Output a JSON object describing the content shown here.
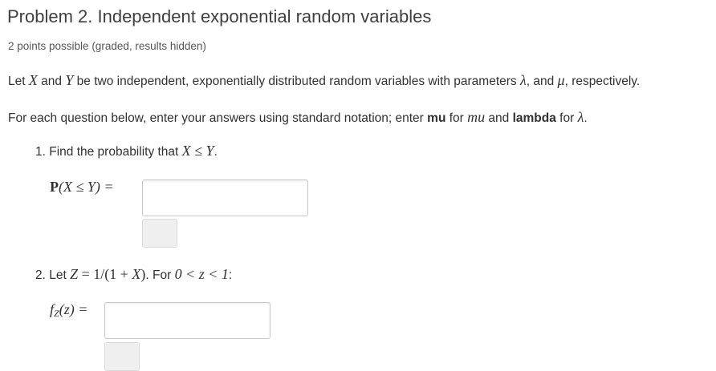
{
  "problem": {
    "title": "Problem 2. Independent exponential random variables",
    "points": "2 points possible (graded, results hidden)"
  },
  "intro": {
    "let": "Let ",
    "X": "X",
    "and": " and ",
    "Y": "Y",
    "desc": " be two independent, exponentially distributed random variables with parameters ",
    "lambda": "λ",
    "and2": ", and ",
    "mu": "μ",
    "end": ", respectively."
  },
  "instructions": {
    "t1": "For each question below, enter your answers using standard notation; enter ",
    "mu_kw": "mu",
    "t2": " for ",
    "mu_italic": "mu",
    "t3": " and ",
    "lambda_kw": "lambda",
    "t4": " for ",
    "lambda": "λ",
    "t5": "."
  },
  "q1": {
    "num": "1. Find the probability that ",
    "expr": "X ≤ Y",
    "end": ".",
    "label_P": "P",
    "label_expr": "(X ≤ Y) ="
  },
  "q2": {
    "num": "2. Let ",
    "Z": "Z",
    "eq": " = 1/(1 + ",
    "X": "X",
    "close": ")",
    "mid": ". For ",
    "range": "0 < z < 1",
    "colon": ":",
    "label_f": "f",
    "label_sub": "Z",
    "label_rest": "(z) ="
  }
}
